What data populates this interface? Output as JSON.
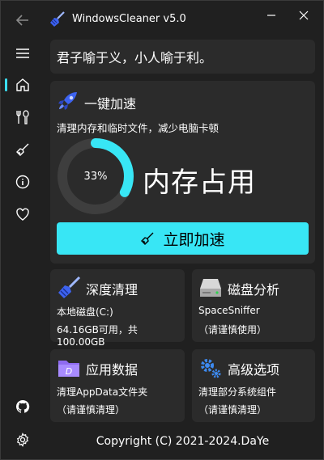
{
  "app": {
    "title": "WindowsCleaner v5.0",
    "accent_color": "#38e6f5"
  },
  "sidebar": {
    "items": [
      {
        "icon": "back-arrow-icon"
      },
      {
        "icon": "hamburger-menu-icon"
      },
      {
        "icon": "home-icon",
        "active": true
      },
      {
        "icon": "tools-icon"
      },
      {
        "icon": "broom-icon"
      },
      {
        "icon": "info-icon"
      },
      {
        "icon": "heart-icon"
      },
      {
        "icon": "github-icon"
      },
      {
        "icon": "settings-icon"
      }
    ]
  },
  "quote": "君子喻于义，小人喻于利。",
  "boost": {
    "title": "一键加速",
    "description": "清理内存和临时文件，减少电脑卡顿",
    "memory_percent_text": "33%",
    "memory_fraction": 0.33,
    "memory_label": "内存占用",
    "button_label": "立即加速"
  },
  "tiles": {
    "deep_clean": {
      "title": "深度清理",
      "line1": "本地磁盘(C:)",
      "line2": "64.16GB可用，共100.00GB"
    },
    "disk_analysis": {
      "title": "磁盘分析",
      "line1": "SpaceSniffer",
      "line2": "（请谨慎使用）"
    },
    "app_data": {
      "title": "应用数据",
      "line1": "清理AppData文件夹",
      "line2": "（请谨慎清理）"
    },
    "advanced": {
      "title": "高级选项",
      "line1": "清理部分系统组件",
      "line2": "（请谨慎清理）"
    }
  },
  "footer": {
    "copyright": "Copyright (C) 2021-2024.DaYe"
  }
}
